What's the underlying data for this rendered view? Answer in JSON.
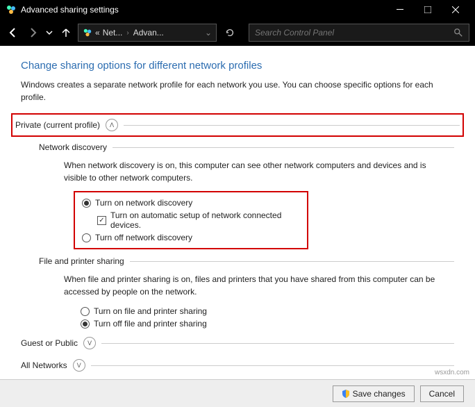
{
  "window": {
    "title": "Advanced sharing settings"
  },
  "address": {
    "prefix": "«",
    "seg1": "Net...",
    "seg2": "Advan..."
  },
  "search": {
    "placeholder": "Search Control Panel"
  },
  "page": {
    "title": "Change sharing options for different network profiles",
    "subtitle": "Windows creates a separate network profile for each network you use. You can choose specific options for each profile."
  },
  "profiles": {
    "private": {
      "label": "Private (current profile)",
      "network_discovery": {
        "title": "Network discovery",
        "desc": "When network discovery is on, this computer can see other network computers and devices and is visible to other network computers.",
        "opt_on": "Turn on network discovery",
        "opt_auto": "Turn on automatic setup of network connected devices.",
        "opt_off": "Turn off network discovery"
      },
      "file_printer": {
        "title": "File and printer sharing",
        "desc": "When file and printer sharing is on, files and printers that you have shared from this computer can be accessed by people on the network.",
        "opt_on": "Turn on file and printer sharing",
        "opt_off": "Turn off file and printer sharing"
      }
    },
    "guest": {
      "label": "Guest or Public"
    },
    "all": {
      "label": "All Networks"
    }
  },
  "footer": {
    "save": "Save changes",
    "cancel": "Cancel"
  },
  "watermark": "wsxdn.com"
}
